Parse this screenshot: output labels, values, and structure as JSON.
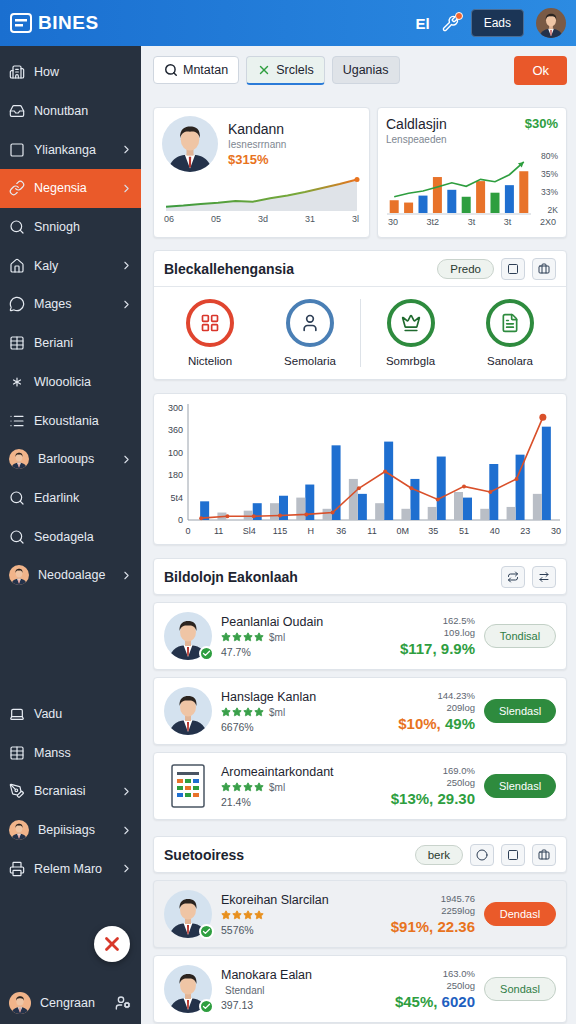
{
  "header": {
    "logo": "BINES",
    "shortcut": "El",
    "account_button": "Eads",
    "notifications": true
  },
  "sidebar": {
    "items": [
      {
        "label": "How",
        "kind": "icon",
        "has_submenu": false,
        "selected": false
      },
      {
        "label": "Nonutban",
        "kind": "icon",
        "has_submenu": false,
        "selected": false
      },
      {
        "label": "Yliankanga",
        "kind": "icon",
        "has_submenu": true,
        "selected": false
      },
      {
        "label": "Negensia",
        "kind": "icon",
        "has_submenu": true,
        "selected": true
      },
      {
        "label": "Snniogh",
        "kind": "icon",
        "has_submenu": false,
        "selected": false
      },
      {
        "label": "Kaly",
        "kind": "icon",
        "has_submenu": true,
        "selected": false
      },
      {
        "label": "Mages",
        "kind": "icon",
        "has_submenu": true,
        "selected": false
      },
      {
        "label": "Beriani",
        "kind": "icon",
        "has_submenu": false,
        "selected": false
      },
      {
        "label": "Wlooolicia",
        "kind": "icon",
        "has_submenu": false,
        "selected": false
      },
      {
        "label": "Ekoustlania",
        "kind": "icon",
        "has_submenu": false,
        "selected": false
      },
      {
        "label": "Barlooups",
        "kind": "avatar",
        "has_submenu": true,
        "selected": false
      },
      {
        "label": "Edarlink",
        "kind": "icon",
        "has_submenu": false,
        "selected": false
      },
      {
        "label": "Seodagela",
        "kind": "icon",
        "has_submenu": false,
        "selected": false
      },
      {
        "label": "Neodoalage",
        "kind": "avatar",
        "has_submenu": true,
        "selected": false
      }
    ],
    "bottom_items": [
      {
        "label": "Vadu",
        "kind": "icon",
        "has_submenu": false,
        "selected": false
      },
      {
        "label": "Manss",
        "kind": "icon",
        "has_submenu": false,
        "selected": false
      },
      {
        "label": "Bcraniasi",
        "kind": "icon",
        "has_submenu": true,
        "selected": false
      },
      {
        "label": "Bepiisiags",
        "kind": "avatar",
        "has_submenu": true,
        "selected": false
      },
      {
        "label": "Relem Maro",
        "kind": "icon",
        "has_submenu": true,
        "selected": false
      }
    ],
    "user": {
      "name": "Cengraan"
    }
  },
  "toolbar": {
    "items": [
      {
        "label": "Mntatan",
        "kind": "search",
        "selected": false
      },
      {
        "label": "Srclels",
        "kind": "tab",
        "selected": true
      },
      {
        "label": "Uganias",
        "kind": "tab",
        "selected": false
      }
    ],
    "action": "Ok"
  },
  "kpi_cards": [
    {
      "kind": "line",
      "title": "Kandann",
      "subtitle": "Iesnesrrnann",
      "value": "$315%",
      "color": "#e8731e",
      "series": [
        4,
        6,
        9,
        11,
        14,
        13,
        19,
        24,
        30,
        37,
        44,
        52
      ],
      "x_labels": [
        "06",
        "05",
        "3d",
        "31",
        "3l"
      ]
    },
    {
      "kind": "bar",
      "title": "Caldlasjin",
      "subtitle": "Lenspeaeden",
      "value": "$30%",
      "color": "#2e9e3f",
      "bars": [
        {
          "value": 22,
          "color": "#e8732a"
        },
        {
          "value": 18,
          "color": "#e8732a"
        },
        {
          "value": 30,
          "color": "#1f6fd0"
        },
        {
          "value": 62,
          "color": "#e8732a"
        },
        {
          "value": 40,
          "color": "#1f6fd0"
        },
        {
          "value": 28,
          "color": "#2e9e3f"
        },
        {
          "value": 55,
          "color": "#e8732a"
        },
        {
          "value": 35,
          "color": "#2e9e3f"
        },
        {
          "value": 48,
          "color": "#1f6fd0"
        },
        {
          "value": 72,
          "color": "#e8732a"
        }
      ],
      "trend": [
        28,
        34,
        38,
        45,
        52,
        46,
        58,
        54,
        66,
        88
      ],
      "y_ticks": [
        "80%",
        "35%",
        "33%",
        "2K"
      ],
      "x_labels": [
        "30",
        "3t2",
        "3t",
        "3t",
        "2X0"
      ]
    }
  ],
  "categories": {
    "title": "Bleckallehengansia",
    "button": "Predo",
    "items": [
      {
        "label": "Nictelion",
        "color": "#e0452f"
      },
      {
        "label": "Semolaria",
        "color": "#4a7fb5"
      },
      {
        "label": "Somrbgla",
        "color": "#2e8b3e"
      },
      {
        "label": "Sanolara",
        "color": "#2e8b3e"
      }
    ]
  },
  "chart": {
    "y_ticks": [
      "300",
      "360",
      "100",
      "180",
      "5t4",
      "0"
    ],
    "x_labels": [
      "0",
      "11",
      "Sl4",
      "115",
      "H",
      "36",
      "11",
      "0M",
      "35",
      "51",
      "40",
      "23",
      "30"
    ],
    "series": [
      {
        "kind": "bar",
        "color": "#1f6fd0",
        "values": [
          50,
          0,
          45,
          65,
          95,
          200,
          70,
          210,
          110,
          170,
          60,
          150,
          175,
          250
        ]
      },
      {
        "kind": "bar",
        "color": "#b9bec6",
        "values": [
          0,
          20,
          25,
          45,
          60,
          30,
          110,
          45,
          30,
          35,
          75,
          30,
          35,
          70
        ]
      },
      {
        "kind": "line",
        "color": "#d9502a",
        "values": [
          5,
          10,
          10,
          12,
          15,
          20,
          85,
          130,
          85,
          55,
          90,
          75,
          110,
          275
        ]
      }
    ]
  },
  "lists": [
    {
      "title": "Bildolojn Eakonlaah",
      "button": null,
      "rows": [
        {
          "name": "Peanlanlai Oudain",
          "kind": "person",
          "verified": true,
          "stars": 4,
          "star_color": "#3aa04a",
          "rating_label": "$ml",
          "rate": "47.7%",
          "stats": [
            "162.5%",
            "109.log"
          ],
          "amount": [
            {
              "text": "$117, 9.9%",
              "color": "#2e9e3f"
            }
          ],
          "button": {
            "label": "Tondisal",
            "style": "outline",
            "color": "#2e7d46"
          },
          "selected": false
        },
        {
          "name": "Hanslage Kanlan",
          "kind": "person",
          "verified": false,
          "stars": 4,
          "star_color": "#3aa04a",
          "rating_label": "$ml",
          "rate": "6676%",
          "stats": [
            "144.23%",
            "209log"
          ],
          "amount": [
            {
              "text": "$10%,",
              "color": "#e8731e"
            },
            {
              "text": " 49%",
              "color": "#2e9e3f"
            }
          ],
          "button": {
            "label": "Slendasl",
            "style": "filled",
            "color": "#2e8b3e"
          },
          "selected": false
        },
        {
          "name": "Aromeaintarkondant",
          "kind": "document",
          "verified": false,
          "stars": 4,
          "star_color": "#3aa04a",
          "rating_label": "$ml",
          "rate": "21.4%",
          "stats": [
            "169.0%",
            "250log"
          ],
          "amount": [
            {
              "text": "$13%, 29.30",
              "color": "#2e9e3f"
            }
          ],
          "button": {
            "label": "Slendasl",
            "style": "filled",
            "color": "#2e8b3e"
          },
          "selected": false
        }
      ]
    },
    {
      "title": "Suetooiress",
      "button": "berk",
      "rows": [
        {
          "name": "Ekoreihan Slarcilan",
          "kind": "person",
          "verified": true,
          "stars": 4,
          "star_color": "#e8901e",
          "rate": "5576%",
          "stats": [
            "1945.76",
            "2259log"
          ],
          "amount": [
            {
              "text": "$91%, 22.36",
              "color": "#e8731e"
            }
          ],
          "button": {
            "label": "Dendasl",
            "style": "filled",
            "color": "#ea5a2a"
          },
          "selected": true
        },
        {
          "name": "Manokara Ealan",
          "kind": "person",
          "verified": true,
          "stars": 0,
          "star_color": "#3aa04a",
          "rating_label": "Stendanl",
          "rate": "397.13",
          "stats": [
            "163.0%",
            "250log"
          ],
          "amount": [
            {
              "text": "$45%,",
              "color": "#2e9e3f"
            },
            {
              "text": " 6020",
              "color": "#1f5fc0"
            }
          ],
          "button": {
            "label": "Sondasl",
            "style": "outline",
            "color": "#2e7d46"
          },
          "selected": false
        }
      ]
    }
  ]
}
